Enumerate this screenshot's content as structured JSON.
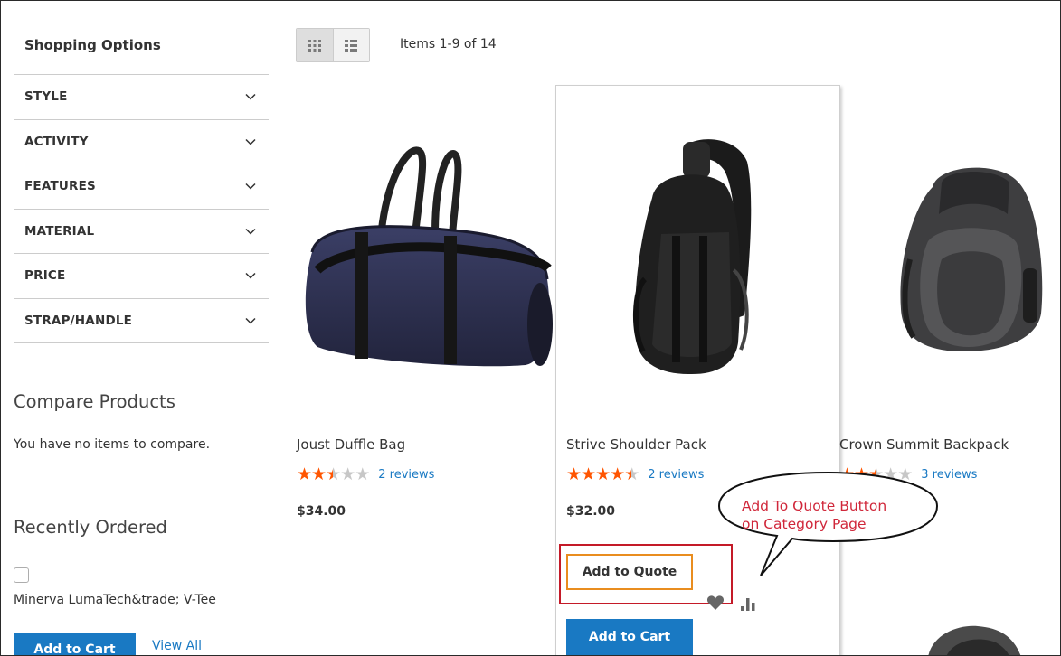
{
  "sidebar": {
    "title": "Shopping Options",
    "filters": [
      {
        "label": "STYLE"
      },
      {
        "label": "ACTIVITY"
      },
      {
        "label": "FEATURES"
      },
      {
        "label": "MATERIAL"
      },
      {
        "label": "PRICE"
      },
      {
        "label": "STRAP/HANDLE"
      }
    ],
    "compare": {
      "title": "Compare Products",
      "empty_text": "You have no items to compare."
    },
    "recently_ordered": {
      "title": "Recently Ordered",
      "item": "Minerva LumaTech&trade; V-Tee",
      "add_to_cart": "Add to Cart",
      "view_all": "View All"
    }
  },
  "toolbar": {
    "amount": "Items 1-9 of 14"
  },
  "products": [
    {
      "name": "Joust Duffle Bag",
      "rating": 2.5,
      "reviews": "2 reviews",
      "price": "$34.00"
    },
    {
      "name": "Strive Shoulder Pack",
      "rating": 4.5,
      "reviews": "2 reviews",
      "price": "$32.00",
      "add_to_quote": "Add to Quote",
      "add_to_cart": "Add to Cart"
    },
    {
      "name": "Crown Summit Backpack",
      "rating": 3.5,
      "reviews": "3 reviews"
    }
  ],
  "callout": {
    "line1": "Add To Quote Button",
    "line2": "on Category Page"
  },
  "colors": {
    "primary": "#1979c3",
    "star": "#ff5501",
    "highlight": "#c41a28",
    "quote_border": "#e98d1f"
  }
}
